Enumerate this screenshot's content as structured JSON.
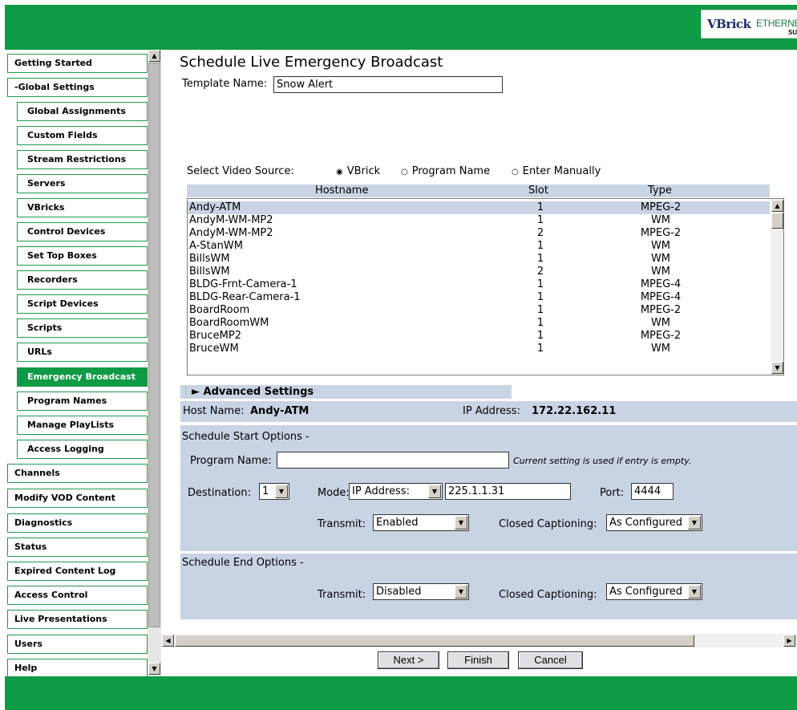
{
  "logo": {
    "brand": "VBrick",
    "product": "ETHERNET",
    "suffix": "SUI"
  },
  "sidebar": {
    "items": [
      {
        "label": "Getting Started"
      },
      {
        "label": "-Global Settings"
      },
      {
        "label": "Global Assignments"
      },
      {
        "label": "Custom Fields"
      },
      {
        "label": "Stream Restrictions"
      },
      {
        "label": "Servers"
      },
      {
        "label": "VBricks"
      },
      {
        "label": "Control Devices"
      },
      {
        "label": "Set Top Boxes"
      },
      {
        "label": "Recorders"
      },
      {
        "label": "Script Devices"
      },
      {
        "label": "Scripts"
      },
      {
        "label": "URLs"
      },
      {
        "label": "Emergency Broadcast"
      },
      {
        "label": "Program Names"
      },
      {
        "label": "Manage PlayLists"
      },
      {
        "label": "Access Logging"
      },
      {
        "label": "Channels"
      },
      {
        "label": "Modify VOD Content"
      },
      {
        "label": "Diagnostics"
      },
      {
        "label": "Status"
      },
      {
        "label": "Expired Content Log"
      },
      {
        "label": "Access Control"
      },
      {
        "label": "Live Presentations"
      },
      {
        "label": "Users"
      },
      {
        "label": "Help"
      }
    ]
  },
  "main": {
    "title": "Schedule Live Emergency Broadcast",
    "template_label": "Template Name:",
    "template_value": "Snow Alert",
    "video_source": {
      "label": "Select Video Source:",
      "options": [
        "VBrick",
        "Program Name",
        "Enter Manually"
      ],
      "selected": "VBrick"
    },
    "table": {
      "headers": [
        "Hostname",
        "Slot",
        "Type"
      ],
      "rows": [
        [
          "Andy-ATM",
          "1",
          "MPEG-2"
        ],
        [
          "AndyM-WM-MP2",
          "1",
          "WM"
        ],
        [
          "AndyM-WM-MP2",
          "2",
          "MPEG-2"
        ],
        [
          "A-StanWM",
          "1",
          "WM"
        ],
        [
          "BillsWM",
          "1",
          "WM"
        ],
        [
          "BillsWM",
          "2",
          "WM"
        ],
        [
          "BLDG-Frnt-Camera-1",
          "1",
          "MPEG-4"
        ],
        [
          "BLDG-Rear-Camera-1",
          "1",
          "MPEG-4"
        ],
        [
          "BoardRoom",
          "1",
          "MPEG-2"
        ],
        [
          "BoardRoomWM",
          "1",
          "WM"
        ],
        [
          "BruceMP2",
          "1",
          "MPEG-2"
        ],
        [
          "BruceWM",
          "1",
          "WM"
        ]
      ],
      "selected_row": 0
    },
    "advanced_label": "Advanced Settings",
    "host": {
      "label": "Host Name:",
      "value": "Andy-ATM",
      "ip_label": "IP Address:",
      "ip_value": "172.22.162.11"
    },
    "start": {
      "heading": "Schedule Start Options -",
      "program_label": "Program Name:",
      "program_value": "",
      "program_hint": "Current setting is used if entry is empty.",
      "destination_label": "Destination:",
      "destination_value": "1",
      "mode_label": "Mode:",
      "mode_value": "IP Address:",
      "address_value": "225.1.1.31",
      "port_label": "Port:",
      "port_value": "4444",
      "transmit_label": "Transmit:",
      "transmit_value": "Enabled",
      "cc_label": "Closed Captioning:",
      "cc_value": "As Configured"
    },
    "end": {
      "heading": "Schedule End Options -",
      "transmit_label": "Transmit:",
      "transmit_value": "Disabled",
      "cc_label": "Closed Captioning:",
      "cc_value": "As Configured"
    },
    "buttons": {
      "next": "Next >",
      "finish": "Finish",
      "cancel": "Cancel"
    }
  },
  "colors": {
    "brand_green": "#0f9a45",
    "panel_blue": "#c8d4e4"
  },
  "icons": [
    "radio-selected-icon",
    "radio-unselected-icon",
    "expand-triangle-icon",
    "dropdown-arrow-icon",
    "scroll-up-icon",
    "scroll-down-icon",
    "scroll-left-icon",
    "scroll-right-icon"
  ]
}
